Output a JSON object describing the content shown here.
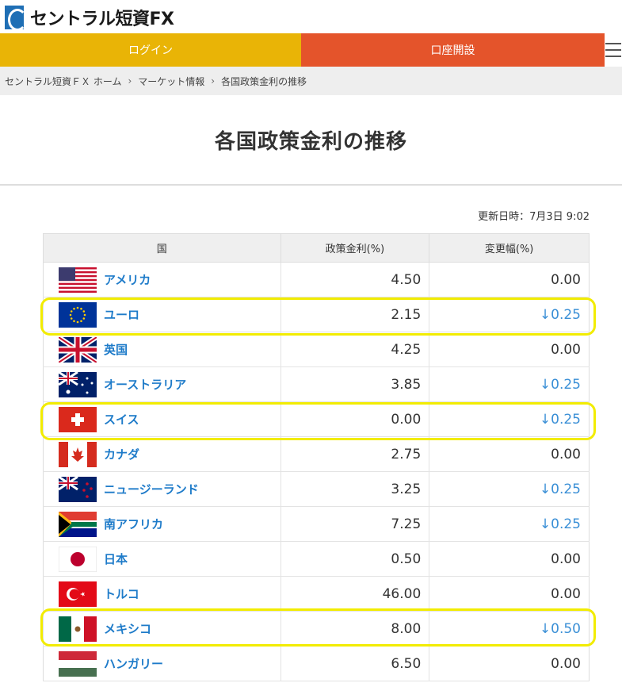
{
  "header": {
    "logo_text": "セントラル短資FX"
  },
  "topbar": {
    "login": "ログイン",
    "open_account": "口座開設"
  },
  "breadcrumb": [
    "セントラル短資ＦＸ ホーム",
    "マーケット情報",
    "各国政策金利の推移"
  ],
  "page_title": "各国政策金利の推移",
  "update": "更新日時：7月3日 9:02",
  "table": {
    "headers": [
      "国",
      "政策金利(%)",
      "変更幅(%)"
    ],
    "rows": [
      {
        "country": "アメリカ",
        "flag": "us-flag",
        "rate": "4.50",
        "change": "0.00",
        "down": false
      },
      {
        "country": "ユーロ",
        "flag": "eu-flag",
        "rate": "2.15",
        "change": "↓0.25",
        "down": true
      },
      {
        "country": "英国",
        "flag": "uk-flag",
        "rate": "4.25",
        "change": "0.00",
        "down": false
      },
      {
        "country": "オーストラリア",
        "flag": "au-flag",
        "rate": "3.85",
        "change": "↓0.25",
        "down": true
      },
      {
        "country": "スイス",
        "flag": "ch-flag",
        "rate": "0.00",
        "change": "↓0.25",
        "down": true
      },
      {
        "country": "カナダ",
        "flag": "ca-flag",
        "rate": "2.75",
        "change": "0.00",
        "down": false
      },
      {
        "country": "ニュージーランド",
        "flag": "nz-flag",
        "rate": "3.25",
        "change": "↓0.25",
        "down": true
      },
      {
        "country": "南アフリカ",
        "flag": "za-flag",
        "rate": "7.25",
        "change": "↓0.25",
        "down": true
      },
      {
        "country": "日本",
        "flag": "jp-flag",
        "rate": "0.50",
        "change": "0.00",
        "down": false
      },
      {
        "country": "トルコ",
        "flag": "tr-flag",
        "rate": "46.00",
        "change": "0.00",
        "down": false
      },
      {
        "country": "メキシコ",
        "flag": "mx-flag",
        "rate": "8.00",
        "change": "↓0.50",
        "down": true
      },
      {
        "country": "ハンガリー",
        "flag": "hu-flag",
        "rate": "6.50",
        "change": "0.00",
        "down": false
      }
    ]
  },
  "colors": {
    "login": "#e9b406",
    "open_account": "#e4542b",
    "link": "#1e7bc9",
    "down": "#3a8fd6",
    "highlight": "#f2ec00"
  }
}
